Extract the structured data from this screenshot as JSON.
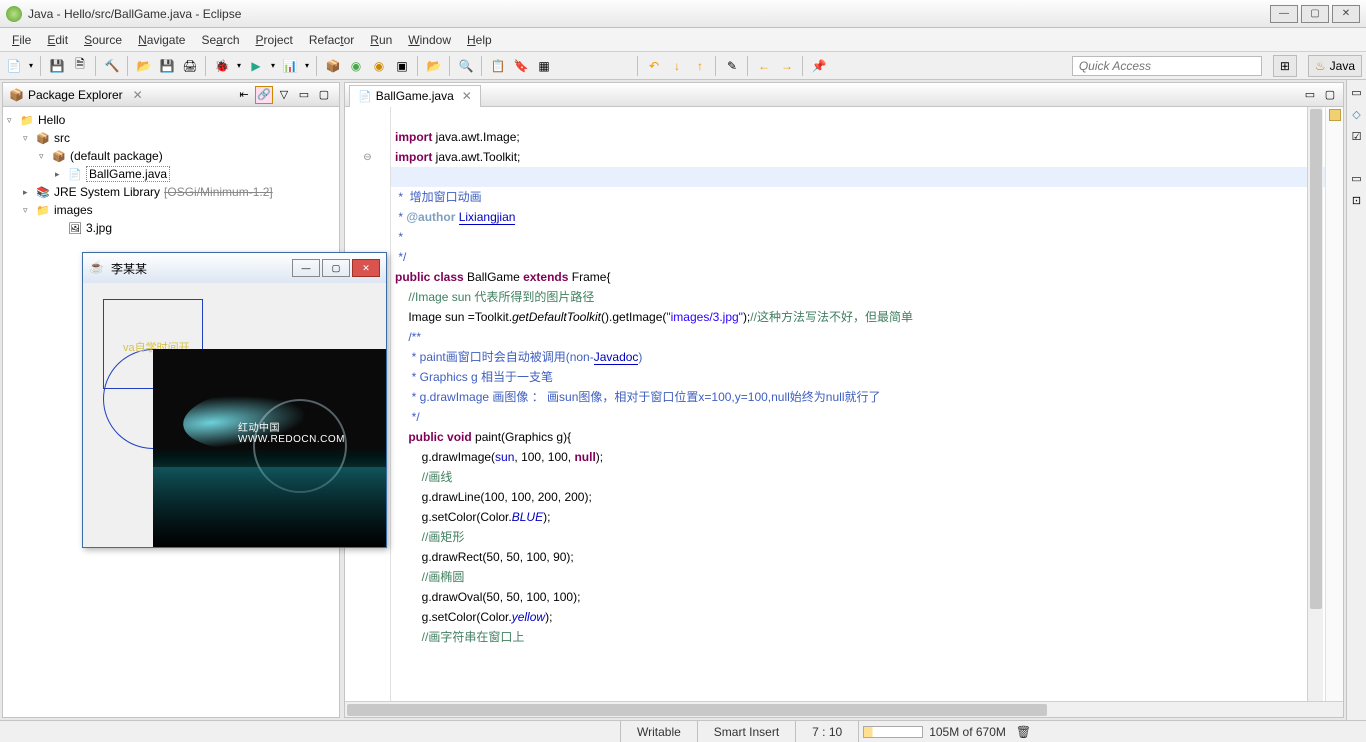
{
  "window": {
    "title": "Java - Hello/src/BallGame.java - Eclipse"
  },
  "menu": [
    "File",
    "Edit",
    "Source",
    "Navigate",
    "Search",
    "Project",
    "Refactor",
    "Run",
    "Window",
    "Help"
  ],
  "quickaccess": {
    "placeholder": "Quick Access"
  },
  "perspective": {
    "label": "Java"
  },
  "explorer": {
    "title": "Package Explorer",
    "project": "Hello",
    "src": "src",
    "pkg": "(default package)",
    "file": "BallGame.java",
    "jre": "JRE System Library",
    "jreprof": "[OSGi/Minimum-1.2]",
    "images": "images",
    "img": "3.jpg"
  },
  "editor": {
    "tab": "BallGame.java"
  },
  "code": {
    "l1a": "import",
    "l1b": " java.awt.Image;",
    "l2a": "import",
    "l2b": " java.awt.Toolkit;",
    "l3": "/**",
    "l4": " *  增加窗口动画",
    "l5a": " * ",
    "l5tag": "@author",
    "l5b": " ",
    "l5auth": "Lixiangjian",
    "l6": " *",
    "l7": " */",
    "l8a": "public",
    "l8b": " class",
    "l8c": " BallGame ",
    "l8d": "extends",
    "l8e": " Frame{",
    "l9a": "    ",
    "l9b": "//Image sun 代表所得到的图片路径",
    "l10a": "    Image sun =Toolkit.",
    "l10b": "getDefaultToolkit",
    "l10c": "().getImage(",
    "l10d": "\"images/3.jpg\"",
    "l10e": ");",
    "l10f": "//这种方法写法不好，但最简单",
    "l11": "    /**",
    "l12a": "     * paint画窗口时会自动被调用(non-",
    "l12b": "Javadoc",
    "l12c": ")",
    "l13": "     * Graphics g 相当于一支笔",
    "l14": "     * g.drawImage 画图像 ： 画sun图像，相对于窗口位置x=100,y=100,null始终为null就行了",
    "l15": "     */",
    "l16a": "    ",
    "l16b": "public",
    "l16c": " void",
    "l16d": " paint(Graphics g){",
    "l17a": "        g.drawImage(",
    "l17b": "sun",
    "l17c": ", 100, 100, ",
    "l17d": "null",
    "l17e": ");",
    "l18a": "        ",
    "l18b": "//画线",
    "l19": "        g.drawLine(100, 100, 200, 200);",
    "l20a": "        g.setColor(Color.",
    "l20b": "BLUE",
    "l20c": ");",
    "l21a": "        ",
    "l21b": "//画矩形",
    "l22": "        g.drawRect(50, 50, 100, 90);",
    "l23a": "        ",
    "l23b": "//画椭圆",
    "l24": "        g.drawOval(50, 50, 100, 100);",
    "l25a": "        g.setColor(Color.",
    "l25b": "yellow",
    "l25c": ");",
    "l26a": "        ",
    "l26b": "//画字符串在窗口上"
  },
  "popup": {
    "title": "李某某",
    "ytext": "va自学时间开",
    "watermark": "红动中国WWW.REDOCN.COM"
  },
  "status": {
    "writable": "Writable",
    "insert": "Smart Insert",
    "pos": "7 : 10",
    "heap": "105M of 670M"
  }
}
